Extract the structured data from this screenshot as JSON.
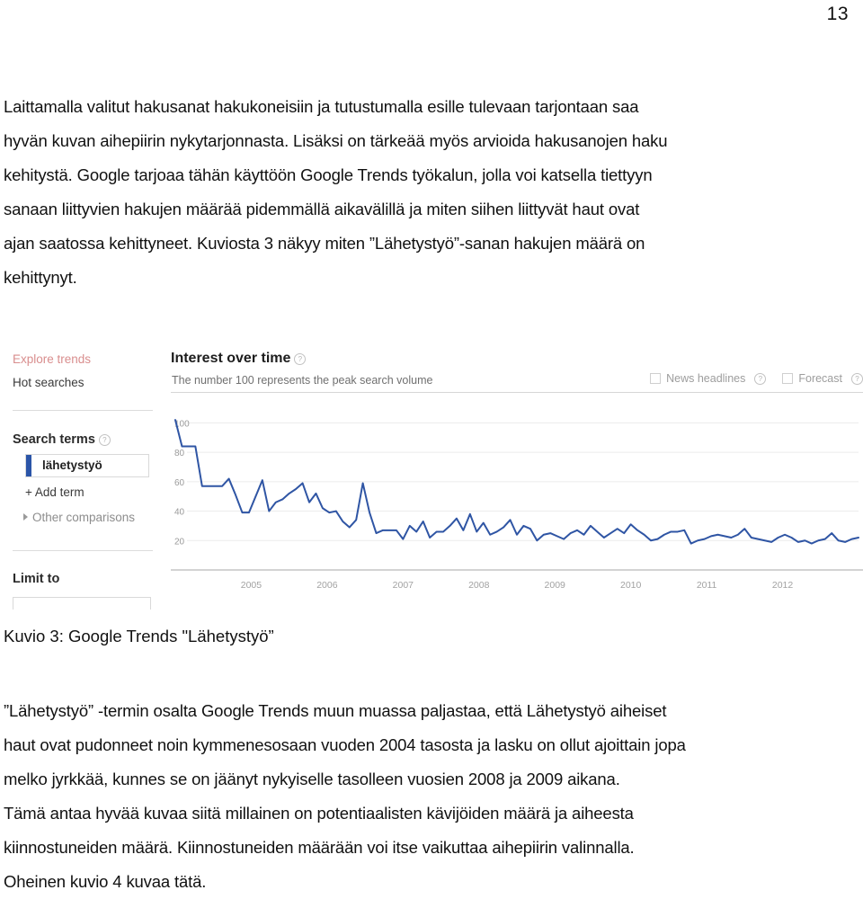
{
  "page": {
    "number": "13"
  },
  "document": {
    "top_paragraph_lines": [
      {
        "text": "Laittamalla valitut hakusanat hakukoneisiin ja tutustumalla esille tulevaan tarjontaan saa",
        "bold": false
      },
      {
        "text": "hyvän kuvan aihepiirin nykytarjonnasta. Lisäksi on tärkeää myös arvioida hakusanojen haku",
        "bold": false
      },
      {
        "text": "kehitystä. Google tarjoaa tähän käyttöön Google Trends työkalun, jolla voi katsella tiettyyn",
        "bold": false
      },
      {
        "text": "sanaan liittyvien hakujen määrää pidemmällä aikavälillä ja miten siihen liittyvät haut ovat",
        "bold": false
      },
      {
        "text": "ajan saatossa kehittyneet. Kuviosta 3 näkyy miten ”Lähetystyö”-sanan hakujen määrä on",
        "bold": false
      },
      {
        "text": "kehittynyt.",
        "bold": false
      }
    ],
    "figure_caption": "Kuvio 3: Google Trends \"Lähetystyö”",
    "bottom_paragraph_lines": [
      {
        "text": "”Lähetystyö” -termin osalta Google Trends muun muassa paljastaa, että Lähetystyö aiheiset"
      },
      {
        "text": "haut ovat pudonneet noin kymmenesosaan vuoden 2004 tasosta ja lasku on ollut ajoittain jopa"
      },
      {
        "text": "melko jyrkkää, kunnes se on jäänyt nykyiselle tasolleen vuosien 2008 ja 2009 aikana."
      },
      {
        "text": "Tämä antaa hyvää kuvaa siitä millainen on potentiaalisten kävijöiden määrä ja aiheesta"
      },
      {
        "text": "kiinnostuneiden määrä. Kiinnostuneiden määrään voi itse vaikuttaa aihepiirin valinnalla."
      },
      {
        "text": "Oheinen kuvio 4 kuvaa tätä."
      }
    ]
  },
  "trends": {
    "sidebar": {
      "explore_trends": "Explore trends",
      "hot_searches": "Hot searches",
      "search_terms_label": "Search terms",
      "search_terms_help": "?",
      "term_value": "lähetystyö",
      "add_term": "+ Add term",
      "other_comparisons": "Other comparisons",
      "limit_to_label": "Limit to",
      "accent_color": "#2b55a8",
      "explore_color": "#d98e8e"
    },
    "main": {
      "title": "Interest over time",
      "title_help": "?",
      "subtitle": "The number 100 represents the peak search volume",
      "toggles": [
        {
          "label": "News headlines",
          "help": "?",
          "checked": false
        },
        {
          "label": "Forecast",
          "help": "?",
          "checked": false
        }
      ]
    }
  },
  "chart_data": {
    "type": "line",
    "title": "Interest over time",
    "subtitle": "The number 100 represents the peak search volume",
    "xlabel": "",
    "ylabel": "",
    "series_name": "lähetystyö",
    "line_color": "#2f55a4",
    "grid": true,
    "legend_position": "none",
    "ylim": [
      0,
      110
    ],
    "yticks": [
      20,
      40,
      60,
      80,
      100
    ],
    "xticks": [
      "2005",
      "2006",
      "2007",
      "2008",
      "2009",
      "2010",
      "2011",
      "2012"
    ],
    "x_start_year": 2004,
    "x_end_year": 2013,
    "values": [
      102,
      84,
      84,
      84,
      57,
      57,
      57,
      57,
      62,
      51,
      39,
      39,
      50,
      61,
      40,
      46,
      48,
      52,
      55,
      59,
      46,
      52,
      42,
      39,
      40,
      33,
      29,
      34,
      59,
      39,
      25,
      27,
      27,
      27,
      21,
      30,
      26,
      33,
      22,
      26,
      26,
      30,
      35,
      27,
      38,
      26,
      32,
      24,
      26,
      29,
      34,
      24,
      30,
      28,
      20,
      24,
      25,
      23,
      21,
      25,
      27,
      24,
      30,
      26,
      22,
      25,
      28,
      25,
      31,
      27,
      24,
      20,
      21,
      24,
      26,
      26,
      27,
      18,
      20,
      21,
      23,
      24,
      23,
      22,
      24,
      28,
      22,
      21,
      20,
      19,
      22,
      24,
      22,
      19,
      20,
      18,
      20,
      21,
      25,
      20,
      19,
      21,
      22
    ]
  }
}
